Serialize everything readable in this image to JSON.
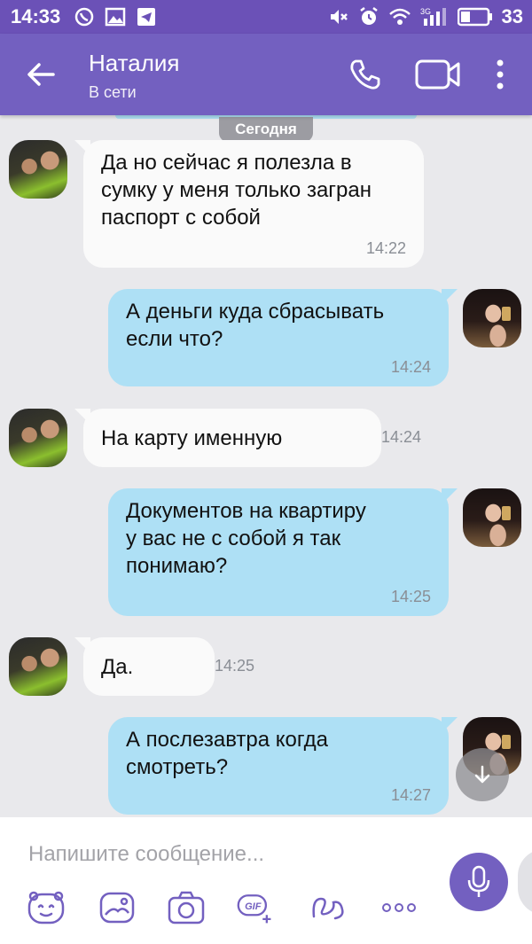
{
  "status_bar": {
    "time": "14:33",
    "network": "3G",
    "battery": "33",
    "left_icons": [
      "viber-icon",
      "gallery-icon",
      "telegram-icon"
    ],
    "right_icons": [
      "mute-icon",
      "alarm-icon",
      "wifi-icon",
      "signal-icon",
      "battery-icon"
    ]
  },
  "header": {
    "contact_name": "Наталия",
    "contact_status": "В сети",
    "accent_color": "#7360c0"
  },
  "chat": {
    "date_separator": "Сегодня",
    "messages": [
      {
        "direction": "in",
        "text": "Да но сейчас я полезла в\nсумку у меня только загран\nпаспорт с собой",
        "time": "14:22"
      },
      {
        "direction": "out",
        "text": "А деньги куда сбрасывать\nесли что?",
        "time": "14:24"
      },
      {
        "direction": "in",
        "text": "На карту именную",
        "time": "14:24"
      },
      {
        "direction": "out",
        "text": "Документов на квартиру\nу вас не с собой я так\nпонимаю?",
        "time": "14:25"
      },
      {
        "direction": "in",
        "text": "Да.",
        "time": "14:25"
      },
      {
        "direction": "out",
        "text": "А послезавтра когда\nсмотреть?",
        "time": "14:27"
      }
    ],
    "incoming_bubble_color": "#fafafa",
    "outgoing_bubble_color": "#aee0f5"
  },
  "composer": {
    "placeholder": "Напишите сообщение...",
    "value": "",
    "tools": [
      "sticker-icon",
      "gallery-icon",
      "camera-icon",
      "gif-icon",
      "doodle-icon",
      "more-icon"
    ],
    "gif_label": "GIF"
  }
}
